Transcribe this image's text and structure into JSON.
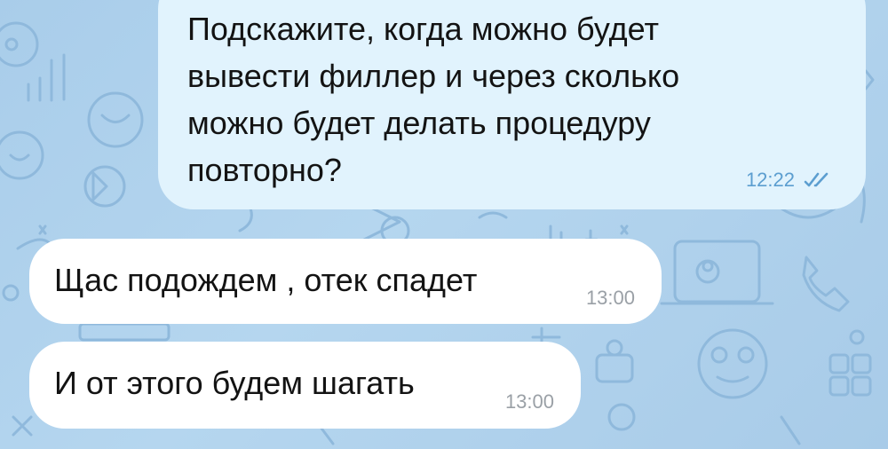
{
  "chat": {
    "messages": [
      {
        "direction": "outgoing",
        "text": "Подскажите, когда можно будет вывести филлер и через сколько можно будет делать процедуру повторно?",
        "time": "12:22",
        "status_icon": "double-check-read-icon"
      },
      {
        "direction": "incoming",
        "text": "Щас подождем , отек спадет",
        "time": "13:00"
      },
      {
        "direction": "incoming",
        "text": "И от этого будем шагать",
        "time": "13:00"
      }
    ]
  },
  "colors": {
    "wallpaper": "#aed0ec",
    "outgoing_bubble": "#e1f3fd",
    "incoming_bubble": "#ffffff",
    "read_checks": "#5c9ed0"
  }
}
